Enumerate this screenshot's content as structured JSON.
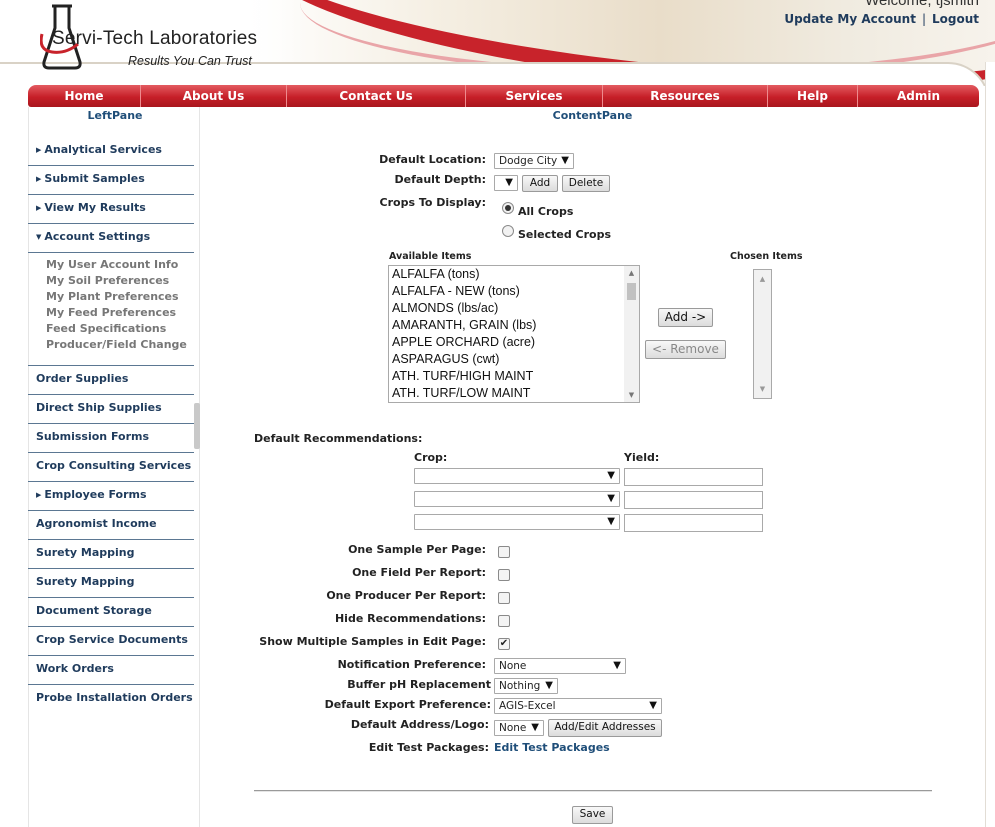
{
  "header": {
    "company": "Servi-Tech Laboratories",
    "tagline": "Results You Can Trust",
    "welcome": "Welcome, tjsmith",
    "update_account": "Update My Account",
    "separator": "|",
    "logout": "Logout"
  },
  "nav": [
    "Home",
    "About Us",
    "Contact Us",
    "Services",
    "Resources",
    "Help",
    "Admin"
  ],
  "left_pane_title": "LeftPane",
  "content_pane_title": "ContentPane",
  "left_menu": {
    "group1": [
      "Analytical Services",
      "Submit Samples",
      "View My Results"
    ],
    "account_settings": "Account Settings",
    "account_sub": [
      "My User Account Info",
      "My Soil Preferences",
      "My Plant Preferences",
      "My Feed Preferences",
      "Feed Specifications",
      "Producer/Field Change"
    ],
    "group2": [
      "Order Supplies",
      "Direct Ship Supplies",
      "Submission Forms",
      "Crop Consulting Services"
    ],
    "employee_forms": "Employee Forms",
    "group3": [
      "Agronomist Income",
      "Surety Mapping",
      "Surety Mapping",
      "Document Storage",
      "Crop Service Documents",
      "Work Orders",
      "Probe Installation Orders"
    ]
  },
  "form": {
    "default_location_label": "Default  Location:",
    "default_location_value": "Dodge City",
    "default_depth_label": "Default Depth:",
    "add_label": "Add",
    "delete_label": "Delete",
    "crops_to_display_label": "Crops To Display:",
    "all_crops": "All Crops",
    "selected_crops": "Selected Crops",
    "available_items_label": "Available Items",
    "chosen_items_label": "Chosen Items",
    "available_items": [
      "ALFALFA (tons)",
      "ALFALFA - NEW (tons)",
      "ALMONDS (lbs/ac)",
      "AMARANTH, GRAIN (lbs)",
      "APPLE ORCHARD (acre)",
      "ASPARAGUS (cwt)",
      "ATH. TURF/HIGH MAINT",
      "ATH. TURF/LOW MAINT"
    ],
    "add_arrow": "Add ->",
    "remove_arrow": "<- Remove",
    "default_recs_label": "Default Recommendations:",
    "crop_label": "Crop:",
    "yield_label": "Yield:",
    "one_sample_label": "One Sample Per Page:",
    "one_field_label": "One Field Per Report:",
    "one_producer_label": "One Producer Per Report:",
    "hide_recs_label": "Hide Recommendations:",
    "show_multiple_label": "Show Multiple Samples in Edit Page:",
    "notification_label": "Notification Preference:",
    "notification_value": "None",
    "buffer_label": "Buffer pH Replacement",
    "buffer_value": "Nothing",
    "export_label": "Default Export Preference:",
    "export_value": "AGIS-Excel",
    "address_label": "Default Address/Logo:",
    "address_value": "None",
    "add_edit_addresses": "Add/Edit Addresses",
    "edit_test_packages_label": "Edit Test Packages:",
    "edit_test_packages_link": "Edit Test Packages",
    "save_label": "Save"
  },
  "colors": {
    "brand_red": "#c61f28",
    "link_blue": "#1f3b5c"
  },
  "icons": {
    "dropdown": "▼",
    "collapsed": "▶",
    "expanded": "▼",
    "check": "✔"
  }
}
